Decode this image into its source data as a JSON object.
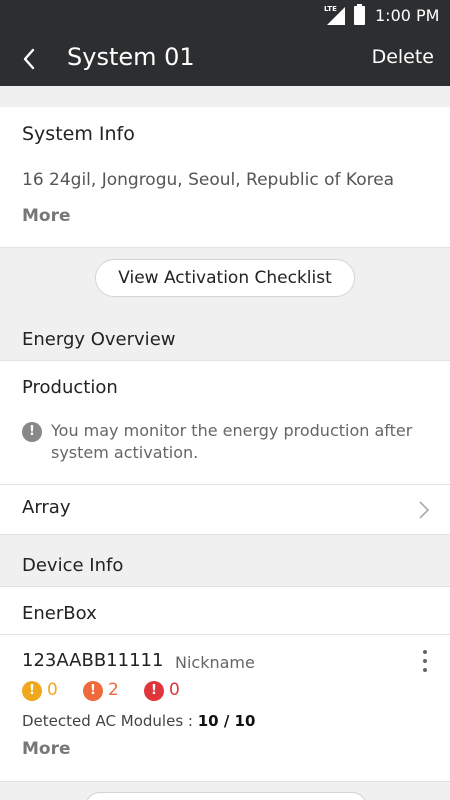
{
  "status_bar": {
    "network": "LTE",
    "time": "1:00 PM"
  },
  "app_bar": {
    "title": "System 01",
    "delete_label": "Delete",
    "back_icon": "chevron-left-icon"
  },
  "system_info": {
    "heading": "System Info",
    "address": "16 24gil, Jongrogu, Seoul, Republic of Korea",
    "more_label": "More"
  },
  "checklist_button": "View Activation Checklist",
  "energy_overview": {
    "label": "Energy Overview",
    "production_heading": "Production",
    "production_note": "You may monitor the energy production after system activation.",
    "info_icon": "!"
  },
  "array": {
    "label": "Array",
    "chevron_icon": "chevron-right-icon"
  },
  "device_info": {
    "label": "Device Info",
    "enerbox_label": "EnerBox",
    "device": {
      "serial": "123AABB11111",
      "nickname": "Nickname",
      "alerts": [
        {
          "icon": "!",
          "count": "0",
          "color": "#f0a81f"
        },
        {
          "icon": "!",
          "count": "2",
          "color": "#ef6a3a"
        },
        {
          "icon": "!",
          "count": "0",
          "color": "#e0363b"
        }
      ],
      "modules_label": "Detected AC Modules :",
      "modules_value": "10 / 10",
      "more_label": "More"
    }
  },
  "colors": {
    "app_bar": "#2d2e30",
    "background": "#f0f0f0",
    "card": "#ffffff"
  }
}
